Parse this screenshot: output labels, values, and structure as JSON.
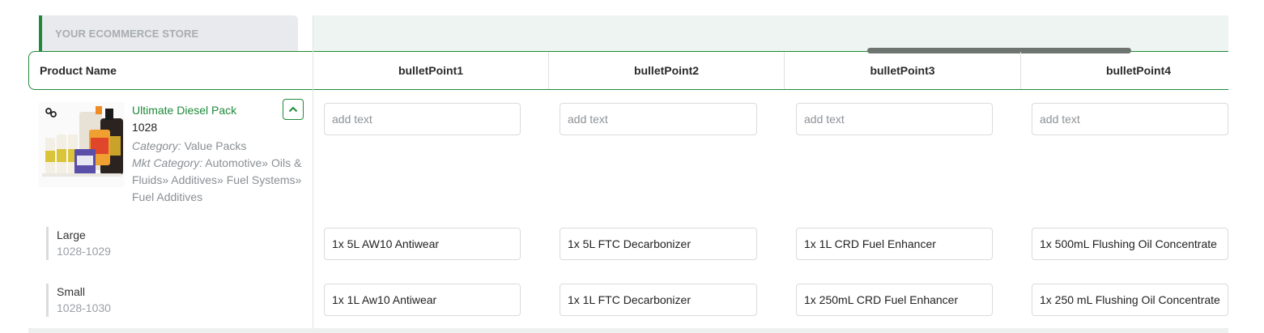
{
  "store": {
    "label": "YOUR ECOMMERCE STORE"
  },
  "columns": {
    "product_name": "Product Name",
    "bullets": [
      "bulletPoint1",
      "bulletPoint2",
      "bulletPoint3",
      "bulletPoint4"
    ]
  },
  "product": {
    "title": "Ultimate Diesel Pack",
    "sku": "1028",
    "category_label": "Category:",
    "category": "Value Packs",
    "mkt_label": "Mkt Category:",
    "mkt_category": "Automotive» Oils & Fluids» Additives» Fuel Systems» Fuel Additives",
    "placeholder": "add text",
    "bullets": [
      "",
      "",
      "",
      ""
    ]
  },
  "variants": [
    {
      "name": "Large",
      "sku": "1028-1029",
      "bullets": [
        "1x 5L AW10 Antiwear",
        "1x 5L FTC Decarbonizer",
        "1x 1L CRD Fuel Enhancer",
        "1x 500mL Flushing Oil Concentrate"
      ]
    },
    {
      "name": "Small",
      "sku": "1028-1030",
      "bullets": [
        "1x 1L Aw10 Antiwear",
        "1x 1L FTC Decarbonizer",
        "1x 250mL CRD Fuel Enhancer",
        "1x 250 mL Flushing Oil Concentrate"
      ]
    }
  ],
  "colors": {
    "accent": "#1e8a3a",
    "header_band": "#eef4f1",
    "muted": "#8a8f94"
  },
  "icons": {
    "collapse": "chevron-up-icon",
    "variations": "link-icon"
  }
}
